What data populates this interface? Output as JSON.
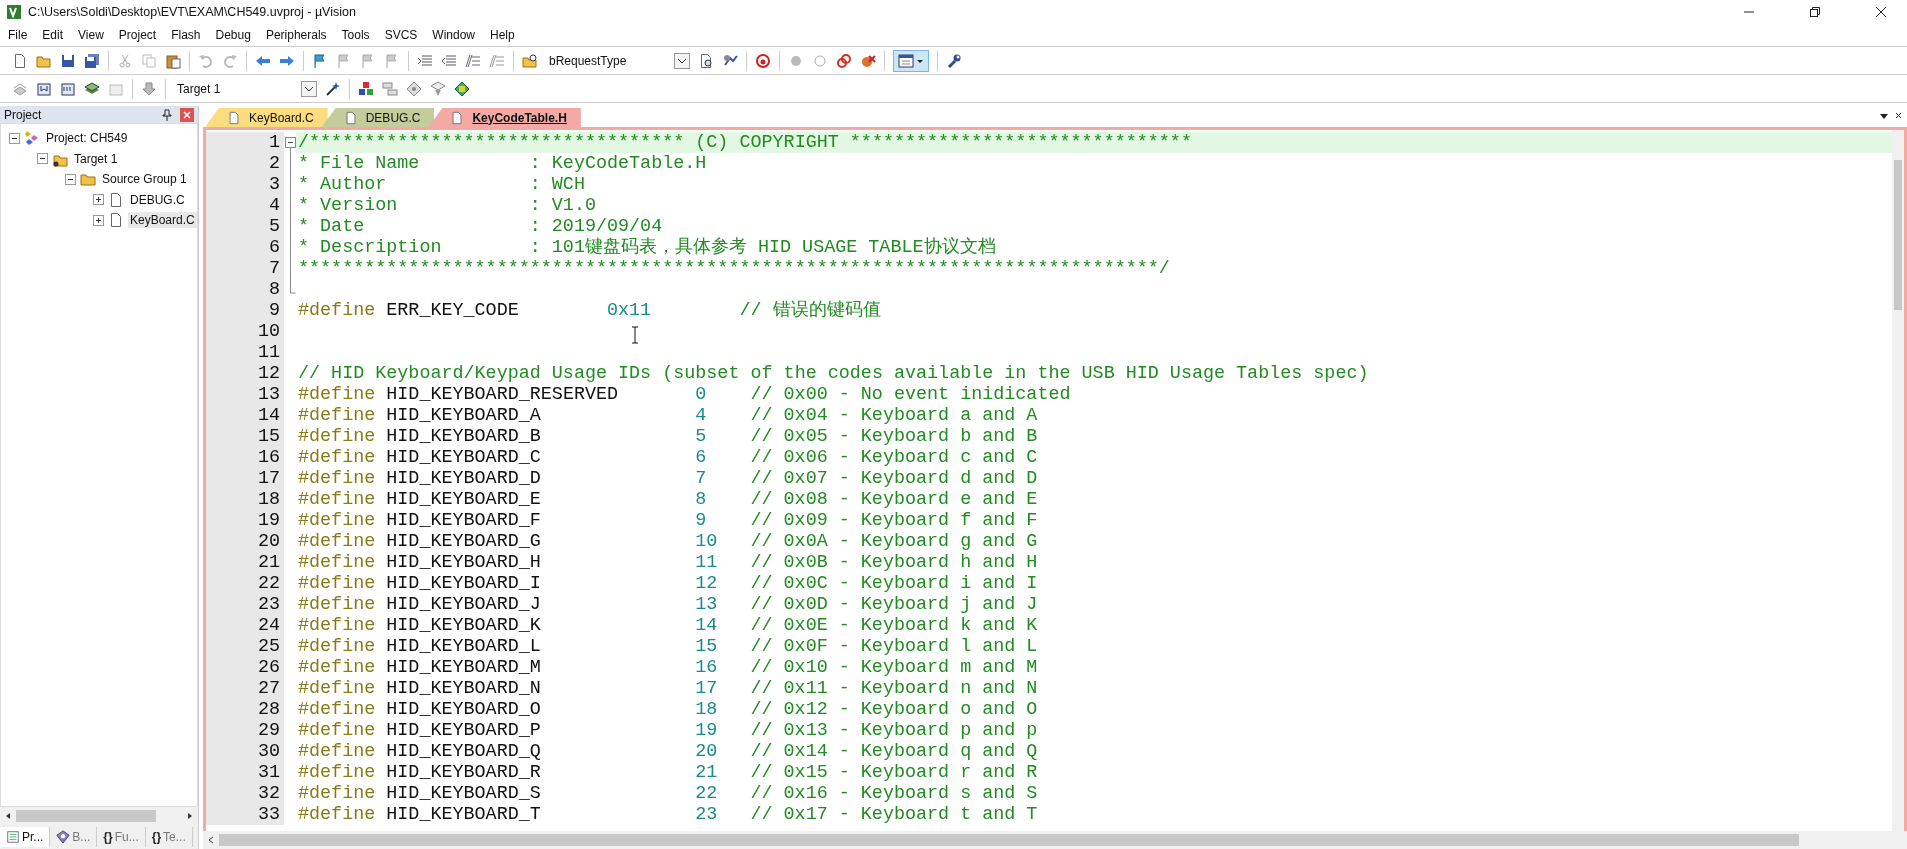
{
  "window": {
    "title": "C:\\Users\\Soldi\\Desktop\\EVT\\EXAM\\CH549.uvproj - µVision"
  },
  "menu": [
    "File",
    "Edit",
    "View",
    "Project",
    "Flash",
    "Debug",
    "Peripherals",
    "Tools",
    "SVCS",
    "Window",
    "Help"
  ],
  "toolbar": {
    "find_combo": "bRequestType",
    "target_combo": "Target 1"
  },
  "project_panel": {
    "title": "Project",
    "tree": [
      {
        "label": "Project: CH549",
        "kind": "project",
        "expanded": true,
        "selected": false,
        "children": [
          {
            "label": "Target 1",
            "kind": "target",
            "expanded": true,
            "selected": false,
            "children": [
              {
                "label": "Source Group 1",
                "kind": "group",
                "expanded": true,
                "selected": false,
                "children": [
                  {
                    "label": "DEBUG.C",
                    "kind": "file",
                    "expanded": false,
                    "selected": false
                  },
                  {
                    "label": "KeyBoard.C",
                    "kind": "file",
                    "expanded": false,
                    "selected": true
                  }
                ]
              }
            ]
          }
        ]
      }
    ],
    "bottom_tabs": [
      {
        "label": "Pr...",
        "kind": "project",
        "selected": true
      },
      {
        "label": "B...",
        "kind": "books",
        "selected": false
      },
      {
        "label": "Fu...",
        "kind": "functions",
        "icon": "{}",
        "selected": false
      },
      {
        "label": "Te...",
        "kind": "templates",
        "icon": "{}",
        "selected": false
      }
    ]
  },
  "editor": {
    "tabs": [
      {
        "label": "KeyBoard.C",
        "color": "#fbdd80",
        "selected": false
      },
      {
        "label": "DEBUG.C",
        "color": "#c4cc9c",
        "selected": false
      },
      {
        "label": "KeyCodeTable.H",
        "color": "#f4aaa4",
        "selected": true
      }
    ],
    "lines": [
      {
        "num": "1",
        "kind": "comment",
        "expanded": true,
        "current": true,
        "text": "/********************************** (C) COPYRIGHT *******************************",
        "children": [
          {
            "num": "2",
            "kind": "comment",
            "current": false,
            "text": "* File Name          : KeyCodeTable.H"
          },
          {
            "num": "3",
            "kind": "comment",
            "current": false,
            "text": "* Author             : WCH"
          },
          {
            "num": "4",
            "kind": "comment",
            "current": false,
            "text": "* Version            : V1.0"
          },
          {
            "num": "5",
            "kind": "comment",
            "current": false,
            "text": "* Date               : 2019/09/04"
          },
          {
            "num": "6",
            "kind": "comment",
            "current": false,
            "text": "* Description        : 101键盘码表，具体参考 HID USAGE TABLE协议文档"
          },
          {
            "num": "7",
            "kind": "comment",
            "current": false,
            "text": "******************************************************************************/"
          },
          {
            "num": "8",
            "kind": "blank",
            "current": false
          }
        ]
      },
      {
        "num": "9",
        "kind": "macro",
        "current": false,
        "keyword": "#define",
        "name": "ERR_KEY_CODE",
        "value": "0x11",
        "comment": "// 错误的键码值"
      },
      {
        "num": "10",
        "kind": "blank",
        "current": false
      },
      {
        "num": "11",
        "kind": "blank",
        "current": false
      },
      {
        "num": "12",
        "kind": "comment",
        "current": false,
        "text": "// HID Keyboard/Keypad Usage IDs (subset of the codes available in the USB HID Usage Tables spec)"
      },
      {
        "num": "13",
        "kind": "keycode",
        "current": false,
        "keyword": "#define",
        "name": "HID_KEYBOARD_RESERVED",
        "value": "0",
        "comment": "// 0x00 - No event inidicated"
      },
      {
        "num": "14",
        "kind": "keycode",
        "current": false,
        "keyword": "#define",
        "name": "HID_KEYBOARD_A",
        "value": "4",
        "comment": "// 0x04 - Keyboard a and A"
      },
      {
        "num": "15",
        "kind": "keycode",
        "current": false,
        "keyword": "#define",
        "name": "HID_KEYBOARD_B",
        "value": "5",
        "comment": "// 0x05 - Keyboard b and B"
      },
      {
        "num": "16",
        "kind": "keycode",
        "current": false,
        "keyword": "#define",
        "name": "HID_KEYBOARD_C",
        "value": "6",
        "comment": "// 0x06 - Keyboard c and C"
      },
      {
        "num": "17",
        "kind": "keycode",
        "current": false,
        "keyword": "#define",
        "name": "HID_KEYBOARD_D",
        "value": "7",
        "comment": "// 0x07 - Keyboard d and D"
      },
      {
        "num": "18",
        "kind": "keycode",
        "current": false,
        "keyword": "#define",
        "name": "HID_KEYBOARD_E",
        "value": "8",
        "comment": "// 0x08 - Keyboard e and E"
      },
      {
        "num": "19",
        "kind": "keycode",
        "current": false,
        "keyword": "#define",
        "name": "HID_KEYBOARD_F",
        "value": "9",
        "comment": "// 0x09 - Keyboard f and F"
      },
      {
        "num": "20",
        "kind": "keycode",
        "current": false,
        "keyword": "#define",
        "name": "HID_KEYBOARD_G",
        "value": "10",
        "comment": "// 0x0A - Keyboard g and G"
      },
      {
        "num": "21",
        "kind": "keycode",
        "current": false,
        "keyword": "#define",
        "name": "HID_KEYBOARD_H",
        "value": "11",
        "comment": "// 0x0B - Keyboard h and H"
      },
      {
        "num": "22",
        "kind": "keycode",
        "current": false,
        "keyword": "#define",
        "name": "HID_KEYBOARD_I",
        "value": "12",
        "comment": "// 0x0C - Keyboard i and I"
      },
      {
        "num": "23",
        "kind": "keycode",
        "current": false,
        "keyword": "#define",
        "name": "HID_KEYBOARD_J",
        "value": "13",
        "comment": "// 0x0D - Keyboard j and J"
      },
      {
        "num": "24",
        "kind": "keycode",
        "current": false,
        "keyword": "#define",
        "name": "HID_KEYBOARD_K",
        "value": "14",
        "comment": "// 0x0E - Keyboard k and K"
      },
      {
        "num": "25",
        "kind": "keycode",
        "current": false,
        "keyword": "#define",
        "name": "HID_KEYBOARD_L",
        "value": "15",
        "comment": "// 0x0F - Keyboard l and L"
      },
      {
        "num": "26",
        "kind": "keycode",
        "current": false,
        "keyword": "#define",
        "name": "HID_KEYBOARD_M",
        "value": "16",
        "comment": "// 0x10 - Keyboard m and M"
      },
      {
        "num": "27",
        "kind": "keycode",
        "current": false,
        "keyword": "#define",
        "name": "HID_KEYBOARD_N",
        "value": "17",
        "comment": "// 0x11 - Keyboard n and N"
      },
      {
        "num": "28",
        "kind": "keycode",
        "current": false,
        "keyword": "#define",
        "name": "HID_KEYBOARD_O",
        "value": "18",
        "comment": "// 0x12 - Keyboard o and O"
      },
      {
        "num": "29",
        "kind": "keycode",
        "current": false,
        "keyword": "#define",
        "name": "HID_KEYBOARD_P",
        "value": "19",
        "comment": "// 0x13 - Keyboard p and p"
      },
      {
        "num": "30",
        "kind": "keycode",
        "current": false,
        "keyword": "#define",
        "name": "HID_KEYBOARD_Q",
        "value": "20",
        "comment": "// 0x14 - Keyboard q and Q"
      },
      {
        "num": "31",
        "kind": "keycode",
        "current": false,
        "keyword": "#define",
        "name": "HID_KEYBOARD_R",
        "value": "21",
        "comment": "// 0x15 - Keyboard r and R"
      },
      {
        "num": "32",
        "kind": "keycode",
        "current": false,
        "keyword": "#define",
        "name": "HID_KEYBOARD_S",
        "value": "22",
        "comment": "// 0x16 - Keyboard s and S"
      },
      {
        "num": "33",
        "kind": "keycode",
        "current": false,
        "keyword": "#define",
        "name": "HID_KEYBOARD_T",
        "value": "23",
        "comment": "// 0x17 - Keyboard t and T"
      }
    ]
  }
}
